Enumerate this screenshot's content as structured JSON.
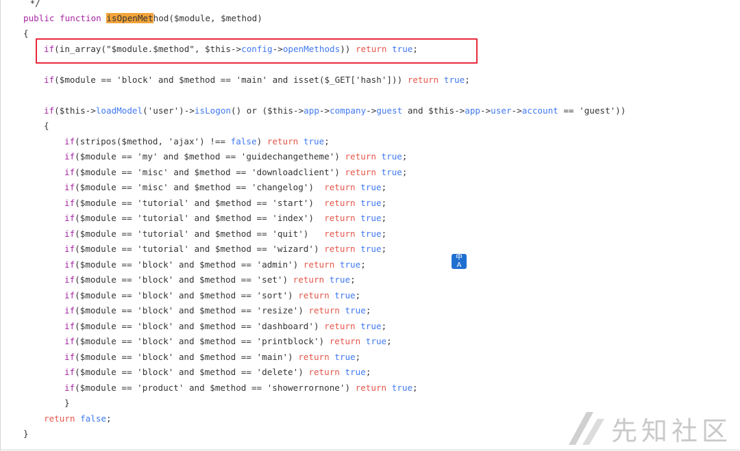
{
  "code": {
    "lines": [
      [
        [
          "punct",
          " */"
        ]
      ],
      [
        [
          "kw",
          "public"
        ],
        [
          "punct",
          " "
        ],
        [
          "kw",
          "function"
        ],
        [
          "punct",
          " "
        ],
        [
          "hl",
          "isOpenMet"
        ],
        [
          "fn",
          "hod"
        ],
        [
          "punct",
          "($module, $method)"
        ]
      ],
      [
        [
          "punct",
          "{"
        ]
      ],
      [
        [
          "kw",
          "if"
        ],
        [
          "punct",
          "(in_array(\"$module.$method\", $this->"
        ],
        [
          "prop",
          "config"
        ],
        [
          "punct",
          "->"
        ],
        [
          "prop",
          "openMethods"
        ],
        [
          "punct",
          ")) "
        ],
        [
          "ret",
          "return"
        ],
        [
          "punct",
          " "
        ],
        [
          "bool",
          "true"
        ],
        [
          "punct",
          ";"
        ]
      ],
      [],
      [
        [
          "kw",
          "if"
        ],
        [
          "punct",
          "($module == 'block' and $method == 'main' and isset($_GET['hash'])) "
        ],
        [
          "ret",
          "return"
        ],
        [
          "punct",
          " "
        ],
        [
          "bool",
          "true"
        ],
        [
          "punct",
          ";"
        ]
      ],
      [],
      [
        [
          "kw",
          "if"
        ],
        [
          "punct",
          "($this->"
        ],
        [
          "prop",
          "loadModel"
        ],
        [
          "punct",
          "('user')->"
        ],
        [
          "prop",
          "isLogon"
        ],
        [
          "punct",
          "() or ($this->"
        ],
        [
          "prop",
          "app"
        ],
        [
          "punct",
          "->"
        ],
        [
          "prop",
          "company"
        ],
        [
          "punct",
          "->"
        ],
        [
          "prop",
          "guest"
        ],
        [
          "punct",
          " and $this->"
        ],
        [
          "prop",
          "app"
        ],
        [
          "punct",
          "->"
        ],
        [
          "prop",
          "user"
        ],
        [
          "punct",
          "->"
        ],
        [
          "prop",
          "account"
        ],
        [
          "punct",
          " == 'guest'))"
        ]
      ],
      [
        [
          "punct",
          "{"
        ]
      ],
      [
        [
          "kw",
          "if"
        ],
        [
          "punct",
          "(stripos($method, 'ajax') !== "
        ],
        [
          "bool",
          "false"
        ],
        [
          "punct",
          ") "
        ],
        [
          "ret",
          "return"
        ],
        [
          "punct",
          " "
        ],
        [
          "bool",
          "true"
        ],
        [
          "punct",
          ";"
        ]
      ],
      [
        [
          "kw",
          "if"
        ],
        [
          "punct",
          "($module == 'my' and $method == 'guidechangetheme') "
        ],
        [
          "ret",
          "return"
        ],
        [
          "punct",
          " "
        ],
        [
          "bool",
          "true"
        ],
        [
          "punct",
          ";"
        ]
      ],
      [
        [
          "kw",
          "if"
        ],
        [
          "punct",
          "($module == 'misc' and $method == 'downloadclient') "
        ],
        [
          "ret",
          "return"
        ],
        [
          "punct",
          " "
        ],
        [
          "bool",
          "true"
        ],
        [
          "punct",
          ";"
        ]
      ],
      [
        [
          "kw",
          "if"
        ],
        [
          "punct",
          "($module == 'misc' and $method == 'changelog')  "
        ],
        [
          "ret",
          "return"
        ],
        [
          "punct",
          " "
        ],
        [
          "bool",
          "true"
        ],
        [
          "punct",
          ";"
        ]
      ],
      [
        [
          "kw",
          "if"
        ],
        [
          "punct",
          "($module == 'tutorial' and $method == 'start')  "
        ],
        [
          "ret",
          "return"
        ],
        [
          "punct",
          " "
        ],
        [
          "bool",
          "true"
        ],
        [
          "punct",
          ";"
        ]
      ],
      [
        [
          "kw",
          "if"
        ],
        [
          "punct",
          "($module == 'tutorial' and $method == 'index')  "
        ],
        [
          "ret",
          "return"
        ],
        [
          "punct",
          " "
        ],
        [
          "bool",
          "true"
        ],
        [
          "punct",
          ";"
        ]
      ],
      [
        [
          "kw",
          "if"
        ],
        [
          "punct",
          "($module == 'tutorial' and $method == 'quit')   "
        ],
        [
          "ret",
          "return"
        ],
        [
          "punct",
          " "
        ],
        [
          "bool",
          "true"
        ],
        [
          "punct",
          ";"
        ]
      ],
      [
        [
          "kw",
          "if"
        ],
        [
          "punct",
          "($module == 'tutorial' and $method == 'wizard') "
        ],
        [
          "ret",
          "return"
        ],
        [
          "punct",
          " "
        ],
        [
          "bool",
          "true"
        ],
        [
          "punct",
          ";"
        ]
      ],
      [
        [
          "kw",
          "if"
        ],
        [
          "punct",
          "($module == 'block' and $method == 'admin') "
        ],
        [
          "ret",
          "return"
        ],
        [
          "punct",
          " "
        ],
        [
          "bool",
          "true"
        ],
        [
          "punct",
          ";"
        ]
      ],
      [
        [
          "kw",
          "if"
        ],
        [
          "punct",
          "($module == 'block' and $method == 'set') "
        ],
        [
          "ret",
          "return"
        ],
        [
          "punct",
          " "
        ],
        [
          "bool",
          "true"
        ],
        [
          "punct",
          ";"
        ]
      ],
      [
        [
          "kw",
          "if"
        ],
        [
          "punct",
          "($module == 'block' and $method == 'sort') "
        ],
        [
          "ret",
          "return"
        ],
        [
          "punct",
          " "
        ],
        [
          "bool",
          "true"
        ],
        [
          "punct",
          ";"
        ]
      ],
      [
        [
          "kw",
          "if"
        ],
        [
          "punct",
          "($module == 'block' and $method == 'resize') "
        ],
        [
          "ret",
          "return"
        ],
        [
          "punct",
          " "
        ],
        [
          "bool",
          "true"
        ],
        [
          "punct",
          ";"
        ]
      ],
      [
        [
          "kw",
          "if"
        ],
        [
          "punct",
          "($module == 'block' and $method == 'dashboard') "
        ],
        [
          "ret",
          "return"
        ],
        [
          "punct",
          " "
        ],
        [
          "bool",
          "true"
        ],
        [
          "punct",
          ";"
        ]
      ],
      [
        [
          "kw",
          "if"
        ],
        [
          "punct",
          "($module == 'block' and $method == 'printblock') "
        ],
        [
          "ret",
          "return"
        ],
        [
          "punct",
          " "
        ],
        [
          "bool",
          "true"
        ],
        [
          "punct",
          ";"
        ]
      ],
      [
        [
          "kw",
          "if"
        ],
        [
          "punct",
          "($module == 'block' and $method == 'main') "
        ],
        [
          "ret",
          "return"
        ],
        [
          "punct",
          " "
        ],
        [
          "bool",
          "true"
        ],
        [
          "punct",
          ";"
        ]
      ],
      [
        [
          "kw",
          "if"
        ],
        [
          "punct",
          "($module == 'block' and $method == 'delete') "
        ],
        [
          "ret",
          "return"
        ],
        [
          "punct",
          " "
        ],
        [
          "bool",
          "true"
        ],
        [
          "punct",
          ";"
        ]
      ],
      [
        [
          "kw",
          "if"
        ],
        [
          "punct",
          "($module == 'product' and $method == 'showerrornone') "
        ],
        [
          "ret",
          "return"
        ],
        [
          "punct",
          " "
        ],
        [
          "bool",
          "true"
        ],
        [
          "punct",
          ";"
        ]
      ],
      [
        [
          "punct",
          "}"
        ]
      ],
      [
        [
          "ret",
          "return"
        ],
        [
          "punct",
          " "
        ],
        [
          "bool",
          "false"
        ],
        [
          "punct",
          ";"
        ]
      ],
      [
        [
          "punct",
          "}"
        ]
      ]
    ],
    "indent": [
      1,
      1,
      1,
      2,
      0,
      2,
      0,
      2,
      2,
      3,
      3,
      3,
      3,
      3,
      3,
      3,
      3,
      3,
      3,
      3,
      3,
      3,
      3,
      3,
      3,
      3,
      3,
      2,
      2,
      1
    ]
  },
  "colors": {
    "highlight": "#f1a33a",
    "keyword": "#a626a4",
    "return": "#e45649",
    "bool": "#4078f2",
    "redbox": "#e8283c"
  },
  "overlay": {
    "translate_icon": "translate-icon",
    "translate_glyph_top": "中",
    "translate_glyph_bottom": "A",
    "watermark_text": "先知社区",
    "watermark_logo": "xianzhi-logo"
  }
}
